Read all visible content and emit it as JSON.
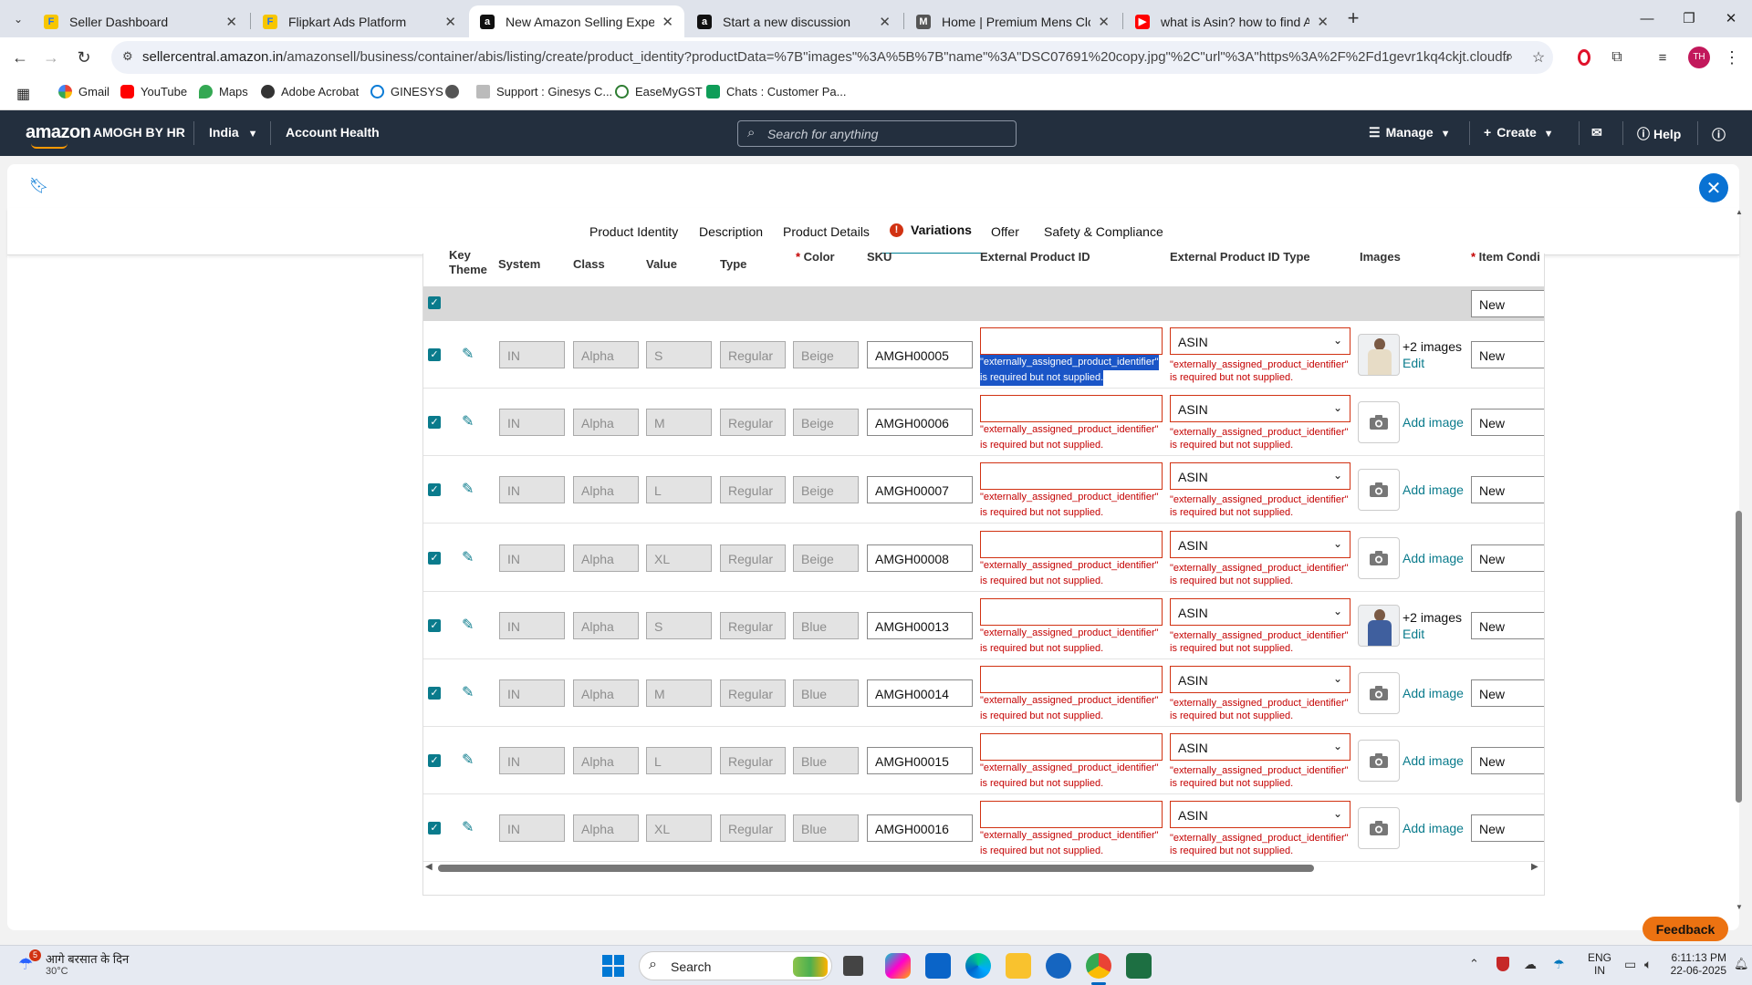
{
  "tabs": [
    {
      "title": "Seller Dashboard",
      "active": false
    },
    {
      "title": "Flipkart Ads Platform",
      "active": false
    },
    {
      "title": "New Amazon Selling Experience",
      "active": true
    },
    {
      "title": "Start a new discussion",
      "active": false
    },
    {
      "title": "Home | Premium Mens Clothing",
      "active": false
    },
    {
      "title": "what is Asin? how to find Asin?",
      "active": false
    }
  ],
  "browser": {
    "url_domain": "sellercentral.amazon.in",
    "url_path": "/amazonsell/business/container/abis/listing/create/product_identity?productData=%7B\"images\"%3A%5B%7B\"name\"%3A\"DSC07691%20copy.jpg\"%2C\"url\"%3A\"https%3A%2F%2Fd1gevr1kq4ckjt.cloudfront.net%2FLI...",
    "profile_initials": "TH"
  },
  "bookmarks": [
    "Gmail",
    "YouTube",
    "Maps",
    "Adobe Acrobat",
    "GINESYS",
    "Support : Ginesys C...",
    "EaseMyGST",
    "Chats : Customer Pa..."
  ],
  "amazon_header": {
    "logo": "amazon",
    "store": "AMOGH BY HR",
    "country": "India",
    "account_health": "Account Health",
    "search_placeholder": "Search for anything",
    "manage": "Manage",
    "create": "Create",
    "help": "Help"
  },
  "steps": [
    "Product Identity",
    "Description",
    "Product Details",
    "Variations",
    "Offer",
    "Safety & Compliance"
  ],
  "active_step": "Variations",
  "columns": {
    "key_theme": "Key Theme",
    "system": "System",
    "class": "Class",
    "value": "Value",
    "type": "Type",
    "color": "Color",
    "sku": "SKU",
    "ext_id": "External Product ID",
    "ext_type": "External Product ID Type",
    "images": "Images",
    "condition": "Item Condi"
  },
  "bulk_condition": "New",
  "error_text_1": "\"externally_assigned_product_identifier\"",
  "error_text_2": "is required but not supplied.",
  "add_image": "Add image",
  "rows": [
    {
      "system": "IN",
      "class": "Alpha",
      "value": "S",
      "type": "Regular",
      "color": "Beige",
      "sku": "AMGH00005",
      "id_type": "ASIN",
      "images": "+2 images",
      "edit": "Edit",
      "condition": "New"
    },
    {
      "system": "IN",
      "class": "Alpha",
      "value": "M",
      "type": "Regular",
      "color": "Beige",
      "sku": "AMGH00006",
      "id_type": "ASIN",
      "images": "",
      "edit": "",
      "condition": "New"
    },
    {
      "system": "IN",
      "class": "Alpha",
      "value": "L",
      "type": "Regular",
      "color": "Beige",
      "sku": "AMGH00007",
      "id_type": "ASIN",
      "images": "",
      "edit": "",
      "condition": "New"
    },
    {
      "system": "IN",
      "class": "Alpha",
      "value": "XL",
      "type": "Regular",
      "color": "Beige",
      "sku": "AMGH00008",
      "id_type": "ASIN",
      "images": "",
      "edit": "",
      "condition": "New"
    },
    {
      "system": "IN",
      "class": "Alpha",
      "value": "S",
      "type": "Regular",
      "color": "Blue",
      "sku": "AMGH00013",
      "id_type": "ASIN",
      "images": "+2 images",
      "edit": "Edit",
      "condition": "New"
    },
    {
      "system": "IN",
      "class": "Alpha",
      "value": "M",
      "type": "Regular",
      "color": "Blue",
      "sku": "AMGH00014",
      "id_type": "ASIN",
      "images": "",
      "edit": "",
      "condition": "New"
    },
    {
      "system": "IN",
      "class": "Alpha",
      "value": "L",
      "type": "Regular",
      "color": "Blue",
      "sku": "AMGH00015",
      "id_type": "ASIN",
      "images": "",
      "edit": "",
      "condition": "New"
    },
    {
      "system": "IN",
      "class": "Alpha",
      "value": "XL",
      "type": "Regular",
      "color": "Blue",
      "sku": "AMGH00016",
      "id_type": "ASIN",
      "images": "",
      "edit": "",
      "condition": "New"
    }
  ],
  "feedback": "Feedback",
  "taskbar": {
    "weather_text": "आगे बरसात के दिन",
    "temp": "30°C",
    "notif_count": "5",
    "search": "Search",
    "lang1": "ENG",
    "lang2": "IN",
    "time": "6:11:13 PM",
    "date": "22-06-2025"
  },
  "colors": {
    "accent": "#008296",
    "error": "#c40000",
    "header": "#232f3e",
    "feedback": "#ec7211"
  }
}
